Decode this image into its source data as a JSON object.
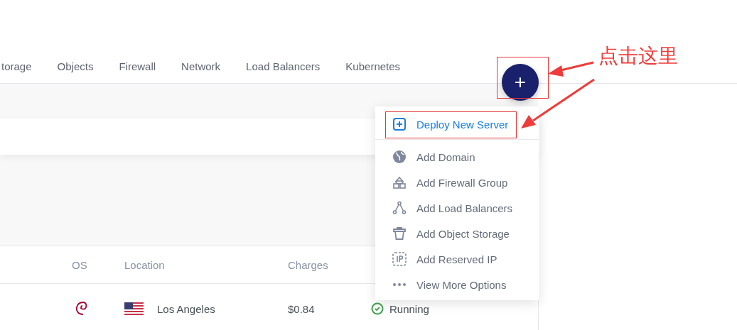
{
  "tabs": [
    {
      "label": "torage",
      "selected": false
    },
    {
      "label": "Objects",
      "selected": false
    },
    {
      "label": "Firewall",
      "selected": false
    },
    {
      "label": "Network",
      "selected": false
    },
    {
      "label": "Load Balancers",
      "selected": false
    },
    {
      "label": "Kubernetes",
      "selected": false
    }
  ],
  "add_button": {
    "label": "+"
  },
  "menu": {
    "items": [
      {
        "label": "Deploy New Server",
        "kind": "primary"
      },
      {
        "label": "Add Domain",
        "kind": "normal"
      },
      {
        "label": "Add Firewall Group",
        "kind": "normal"
      },
      {
        "label": "Add Load Balancers",
        "kind": "normal"
      },
      {
        "label": "Add Object Storage",
        "kind": "normal"
      },
      {
        "label": "Add Reserved IP",
        "kind": "normal"
      },
      {
        "label": "View More Options",
        "kind": "normal"
      }
    ]
  },
  "table": {
    "columns": [
      "OS",
      "Location",
      "Charges"
    ],
    "rows": [
      {
        "location": "Los Angeles",
        "charges": "$0.84",
        "status": "Running"
      }
    ]
  },
  "annotation": {
    "label": "点击这里"
  }
}
